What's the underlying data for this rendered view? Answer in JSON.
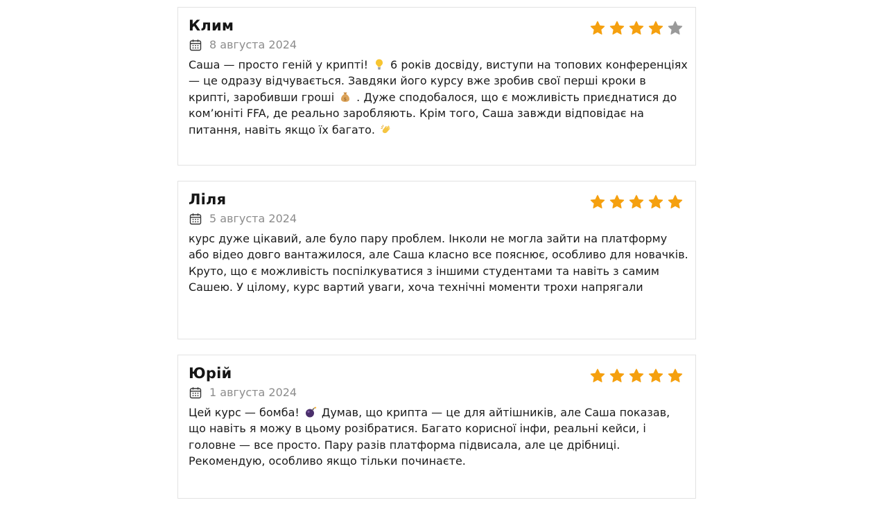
{
  "colors": {
    "star_filled": "#f5a00f",
    "star_empty": "#9a9a9a",
    "date_text": "#8c8c8c",
    "border": "#e2e2e2"
  },
  "reviews": [
    {
      "author": "Клим",
      "date": "8 августа 2024",
      "rating": 4,
      "max_rating": 5,
      "text_parts": [
        "Саша — просто геній у крипті!",
        "6 років досвіду, виступи на топових конференціях — це одразу відчувається. Завдяки його курсу вже зробив свої перші кроки в крипті, заробивши гроші",
        ". Дуже сподобалося, що є можливість приєднатися до ком’юніті FFA, де реально заробляють. Крім того, Саша завжди відповідає на питання, навіть якщо їх багато."
      ],
      "emojis": [
        "lightbulb-emoji",
        "money-bag-emoji",
        "clapping-hands-emoji"
      ]
    },
    {
      "author": "Ліля",
      "date": "5 августа 2024",
      "rating": 5,
      "max_rating": 5,
      "text": "курс дуже цікавий, але було пару проблем. Інколи не могла зайти на платформу або відео довго вантажилося, але Саша класно все пояснює, особливо для новачків. Круто, що є можливість поспілкуватися з іншими студентами та навіть з самим Сашею. У цілому, курс вартий уваги, хоча технічні моменти трохи напрягали"
    },
    {
      "author": "Юрій",
      "date": "1 августа 2024",
      "rating": 5,
      "max_rating": 5,
      "text_parts": [
        "Цей курс — бомба!",
        "Думав, що крипта — це для айтішників, але Саша показав, що навіть я можу в цьому розібратися. Багато корисної інфи, реальні кейси, і головне — все просто. Пару разів платформа підвисала, але це дрібниці. Рекомендую, особливо якщо тільки починаєте."
      ],
      "emojis": [
        "bomb-emoji"
      ]
    }
  ]
}
